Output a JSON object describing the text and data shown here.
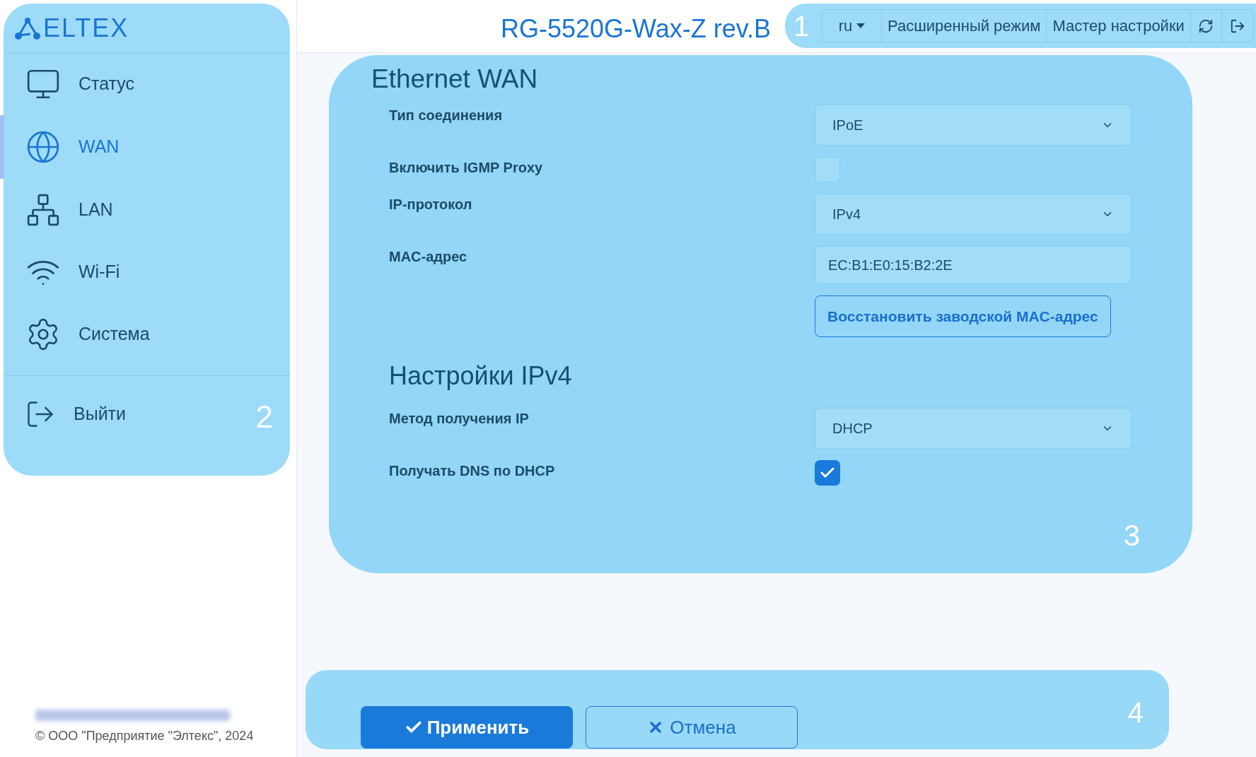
{
  "logo": {
    "text": "ELTEX"
  },
  "header": {
    "title": "RG-5520G-Wax-Z rev.B",
    "marker": "1",
    "toolbar": {
      "language": "ru",
      "buttons": [
        "Расширенный режим",
        "Мастер настройки"
      ]
    }
  },
  "sidebar": {
    "marker": "2",
    "items": [
      {
        "kind": "status",
        "label": "Статус",
        "selected": false
      },
      {
        "kind": "wan",
        "label": "WAN",
        "selected": true
      },
      {
        "kind": "lan",
        "label": "LAN",
        "selected": false
      },
      {
        "kind": "wifi",
        "label": "Wi-Fi",
        "selected": false
      },
      {
        "kind": "system",
        "label": "Система",
        "selected": false
      }
    ],
    "logout": {
      "label": "Выйти"
    }
  },
  "content": {
    "marker": "3",
    "title": "Ethernet WAN",
    "rows": [
      {
        "kind": "select",
        "label": "Тип соединения",
        "value": "IPoE"
      },
      {
        "kind": "checkbox",
        "label": "Включить IGMP Proxy",
        "checked": false
      },
      {
        "kind": "select",
        "label": "IP-протокол",
        "value": "IPv4"
      },
      {
        "kind": "input",
        "label": "MAC-адрес",
        "value": "EC:B1:E0:15:B2:2E"
      },
      {
        "kind": "button",
        "label": "Восстановить заводской MAC-адрес"
      },
      {
        "kind": "heading",
        "label": "Настройки IPv4"
      },
      {
        "kind": "select",
        "label": "Метод получения IP",
        "value": "DHCP"
      },
      {
        "kind": "checkbox",
        "label": "Получать DNS по DHCP",
        "checked": true
      }
    ]
  },
  "actions": {
    "marker": "4",
    "apply": "Применить",
    "cancel": "Отмена"
  },
  "footer": {
    "copyright": "© ООО \"Предприятие \"Элтекс\", 2024"
  }
}
